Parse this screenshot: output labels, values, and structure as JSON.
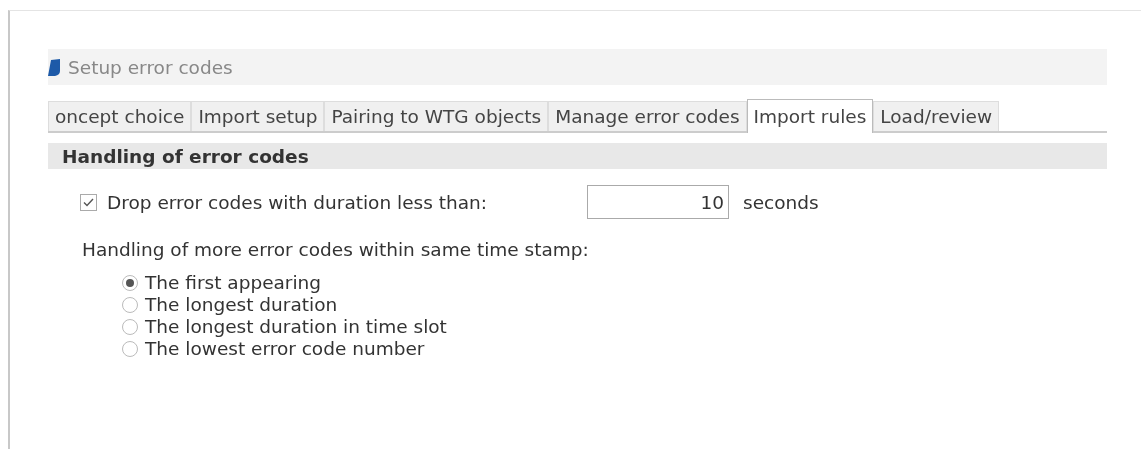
{
  "window": {
    "title": "Setup error codes"
  },
  "tabs": [
    {
      "label": "oncept choice",
      "selected": false
    },
    {
      "label": "Import setup",
      "selected": false
    },
    {
      "label": "Pairing to WTG objects",
      "selected": false
    },
    {
      "label": "Manage error codes",
      "selected": false
    },
    {
      "label": "Import rules",
      "selected": true
    },
    {
      "label": "Load/review",
      "selected": false
    }
  ],
  "section": {
    "title": "Handling of error codes"
  },
  "drop_option": {
    "label": "Drop error codes with duration less than:",
    "checked": true,
    "value": "10",
    "unit": "seconds"
  },
  "handling": {
    "label": "Handling of more error codes within same time stamp:",
    "options": [
      {
        "label": "The first appearing",
        "selected": true
      },
      {
        "label": "The longest duration",
        "selected": false
      },
      {
        "label": "The longest duration in time slot",
        "selected": false
      },
      {
        "label": "The lowest error code number",
        "selected": false
      }
    ]
  }
}
